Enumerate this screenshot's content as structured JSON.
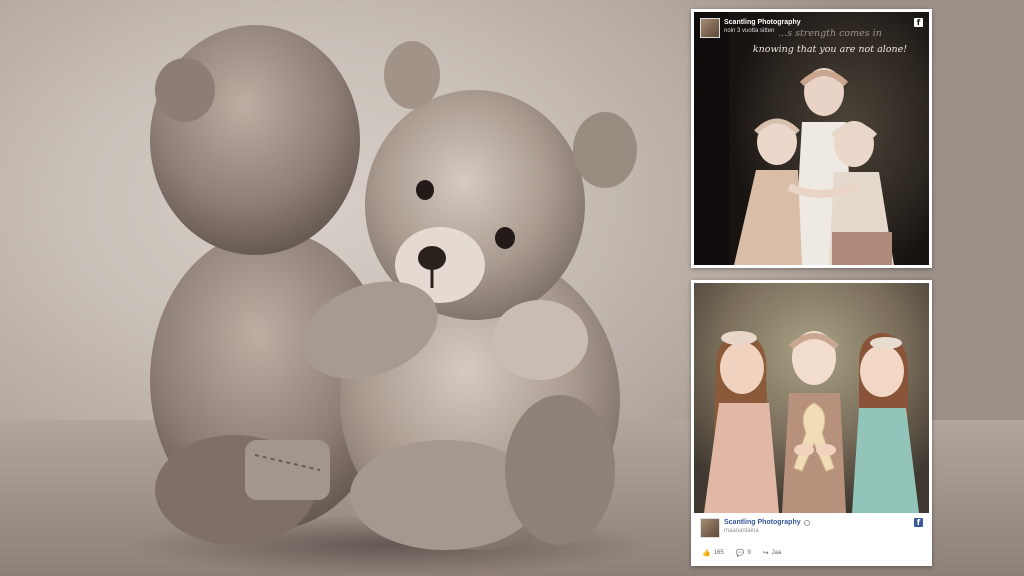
{
  "post_top": {
    "author": "Scantling Photography",
    "time": "noin 3 vuotta sitten",
    "quote_line1": "...s strength comes in",
    "quote_line2": "knowing that you are not alone!",
    "fb_glyph": "f"
  },
  "post_bottom": {
    "author": "Scantling Photography",
    "time": "maanantaina",
    "fb_glyph": "f",
    "likes_count": "165",
    "comments_count": "9",
    "share_label": "Jaa",
    "like_icon": "thumbs-up-icon",
    "comment_icon": "speech-bubble-icon",
    "share_icon": "share-arrow-icon"
  },
  "colors": {
    "facebook_blue": "#3b5998",
    "author_link": "#365899"
  }
}
